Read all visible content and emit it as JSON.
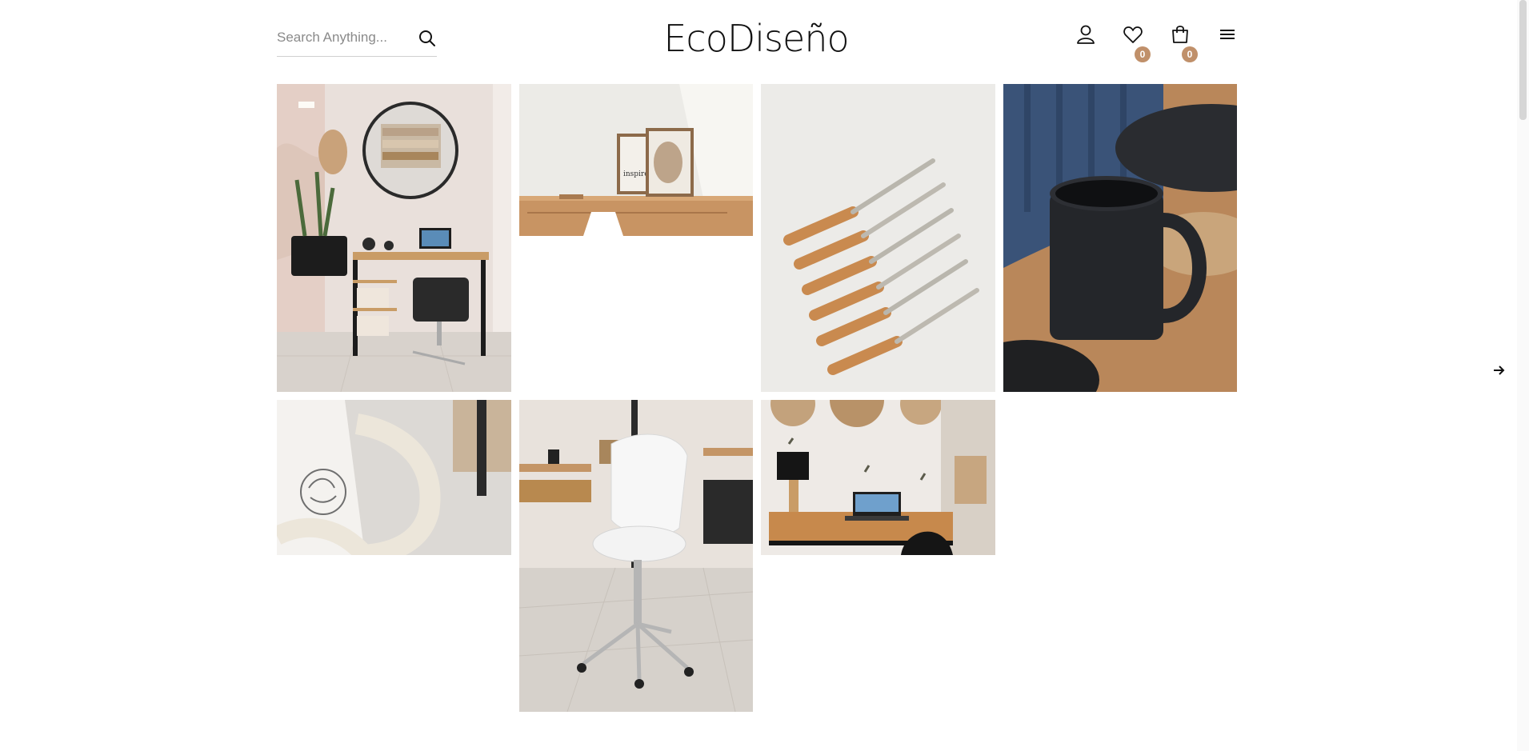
{
  "header": {
    "search_placeholder": "Search Anything...",
    "logo": "EcoDiseño",
    "wishlist_count": "0",
    "cart_count": "0"
  },
  "icons": [
    "search-icon",
    "user-icon",
    "heart-icon",
    "bag-icon",
    "menu-icon",
    "arrow-right-icon"
  ],
  "gallery": {
    "tiles": [
      "desk-room-photo",
      "framed-prints-photo",
      "knives-photo",
      "mug-photo",
      "basket-card-photo",
      "white-chair-photo",
      "desk-laptop-photo"
    ]
  },
  "colors": {
    "badge": "#c0906a",
    "text": "#111111"
  }
}
